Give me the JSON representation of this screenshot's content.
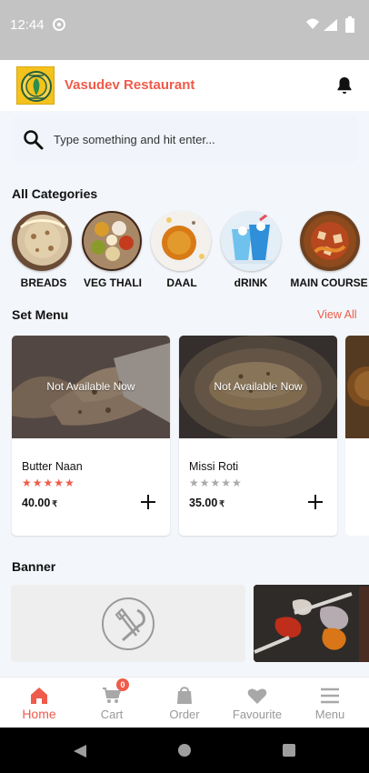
{
  "status": {
    "time": "12:44",
    "icons": [
      "sync-circle-icon",
      "wifi-icon",
      "signal-icon",
      "battery-icon"
    ]
  },
  "header": {
    "restaurant_name": "Vasudev Restaurant",
    "logo_icon": "restaurant-logo",
    "bell_icon": "bell-icon"
  },
  "search": {
    "placeholder": "Type something and hit enter..."
  },
  "sections": {
    "categories": "All Categories",
    "set_menu": "Set Menu",
    "view_all": "View All",
    "banner": "Banner"
  },
  "categories": [
    {
      "label": "BREADS"
    },
    {
      "label": "VEG THALI"
    },
    {
      "label": "DAAL"
    },
    {
      "label": "dRINK"
    },
    {
      "label": "MAIN COURSE"
    }
  ],
  "set_menu": [
    {
      "name": "Butter Naan",
      "availability": "Not Available Now",
      "rating": 5,
      "rating_max": 5,
      "price": "40.00",
      "currency": "₹"
    },
    {
      "name": "Missi Roti",
      "availability": "Not Available Now",
      "rating": 0,
      "rating_max": 5,
      "price": "35.00",
      "currency": "₹"
    }
  ],
  "colors": {
    "accent": "#ef5b4a",
    "background": "#f3f6fa",
    "status_bar": "#c3c3c3"
  },
  "bottom_nav": [
    {
      "label": "Home",
      "icon": "home-icon",
      "active": true
    },
    {
      "label": "Cart",
      "icon": "cart-icon",
      "badge": "0"
    },
    {
      "label": "Order",
      "icon": "bag-icon"
    },
    {
      "label": "Favourite",
      "icon": "heart-icon"
    },
    {
      "label": "Menu",
      "icon": "menu-icon"
    }
  ]
}
